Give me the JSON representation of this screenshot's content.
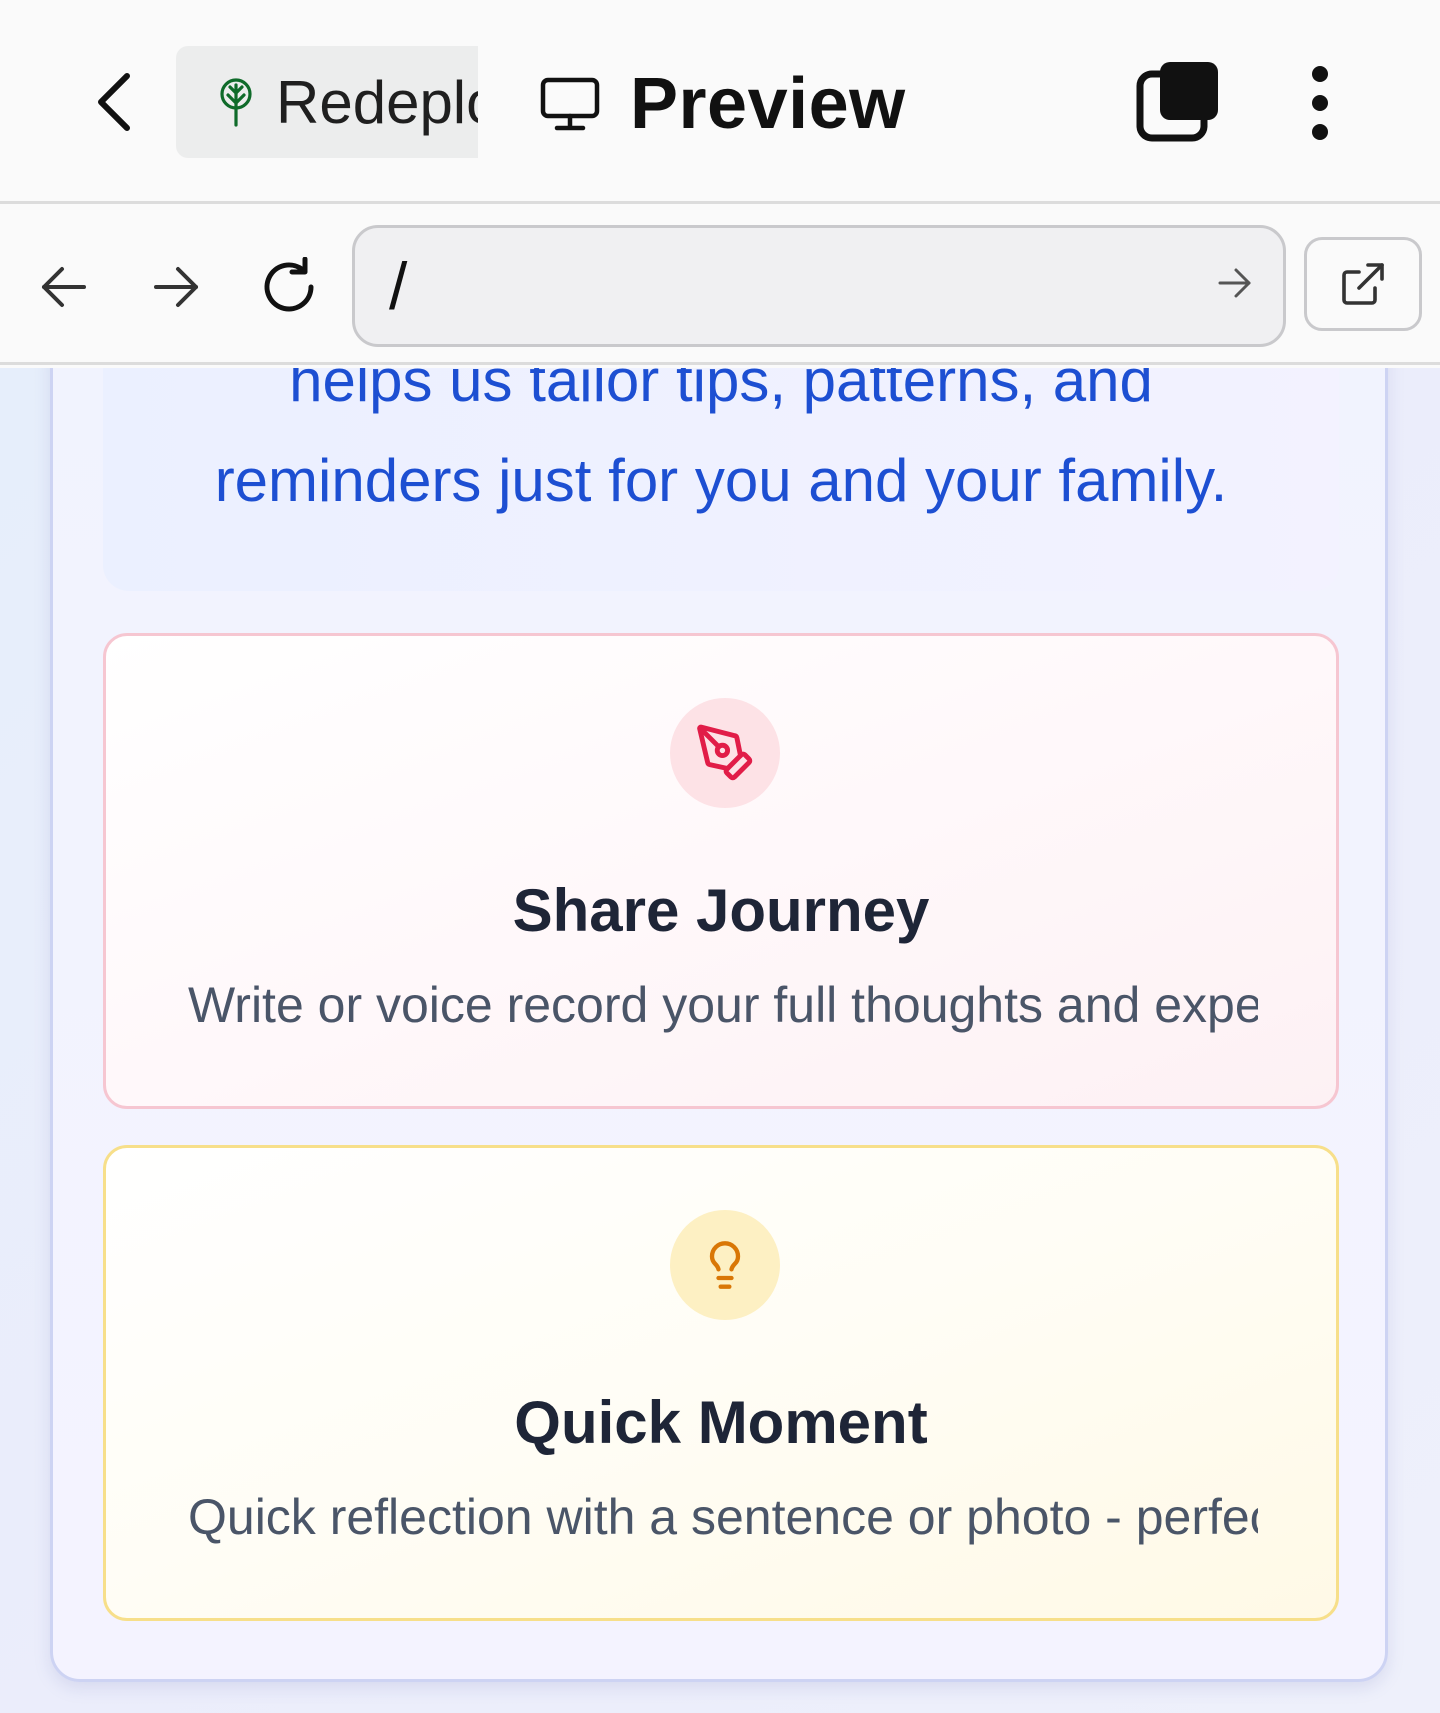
{
  "appbar": {
    "app_tab_label": "Redeploy",
    "preview_tab_label": "Preview"
  },
  "urlbar": {
    "url_value": "/"
  },
  "intro": {
    "line1": "helps us tailor tips, patterns, and",
    "line2": "reminders just for you and your family."
  },
  "cards": [
    {
      "title": "Share Journey",
      "description": "Write or voice record your full thoughts and experiences",
      "icon": "pen-tool-icon",
      "accent": "#e11d48"
    },
    {
      "title": "Quick Moment",
      "description": "Quick reflection with a sentence or photo - perfect for busy days",
      "icon": "lightbulb-icon",
      "accent": "#d97706"
    }
  ],
  "colors": {
    "intro_text": "#1d4fd2",
    "title_text": "#1e2537",
    "desc_text": "#4a5568",
    "tree_icon": "#0f6b2a"
  }
}
